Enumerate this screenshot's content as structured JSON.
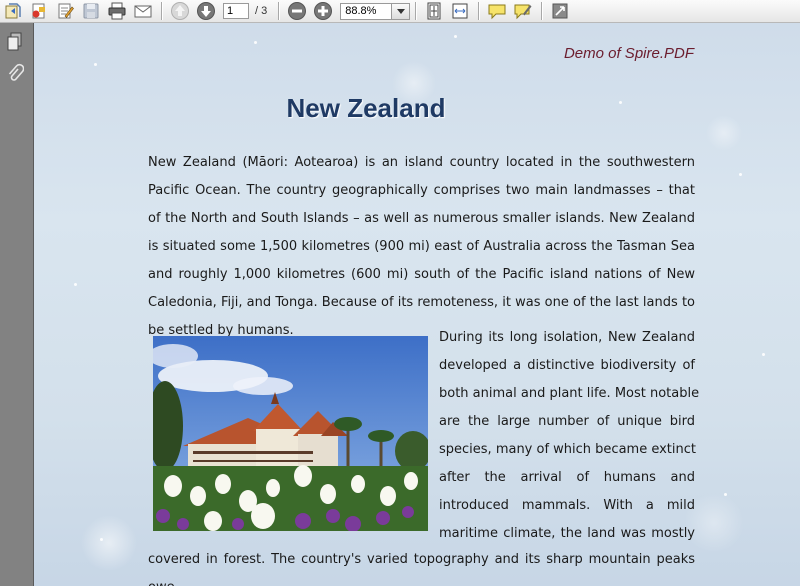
{
  "toolbar": {
    "current_page": "1",
    "page_total": "/ 3",
    "zoom": "88.8%"
  },
  "document": {
    "header": "Demo of Spire.PDF",
    "title": "New Zealand",
    "paragraph1": "New Zealand (Māori: Aotearoa) is an island country located in the southwestern Pacific Ocean. The country geographically comprises two main landmasses – that of the North and South Islands – as well as numerous smaller islands. New Zealand is situated some 1,500 kilometres (900 mi) east of Australia across the Tasman Sea and roughly 1,000 kilometres (600 mi) south of the Pacific island nations of New Caledonia, Fiji, and Tonga. Because of its remoteness, it was one of the last lands to be settled by humans.",
    "paragraph2_lines": [
      "During its long isolation, New Zealand",
      "developed a distinctive biodiversity of",
      "both animal and plant life. Most notable",
      "are the large number of unique bird",
      "species, many of which became extinct",
      "after the arrival of humans and",
      "introduced mammals. With a mild",
      "maritime climate, the land was mostly"
    ],
    "paragraph3": "covered in forest. The country's varied topography and its sharp mountain peaks owe"
  },
  "colors": {
    "title": "#1f3a64",
    "header": "#6b1d2e",
    "sidepanel": "#828282"
  }
}
